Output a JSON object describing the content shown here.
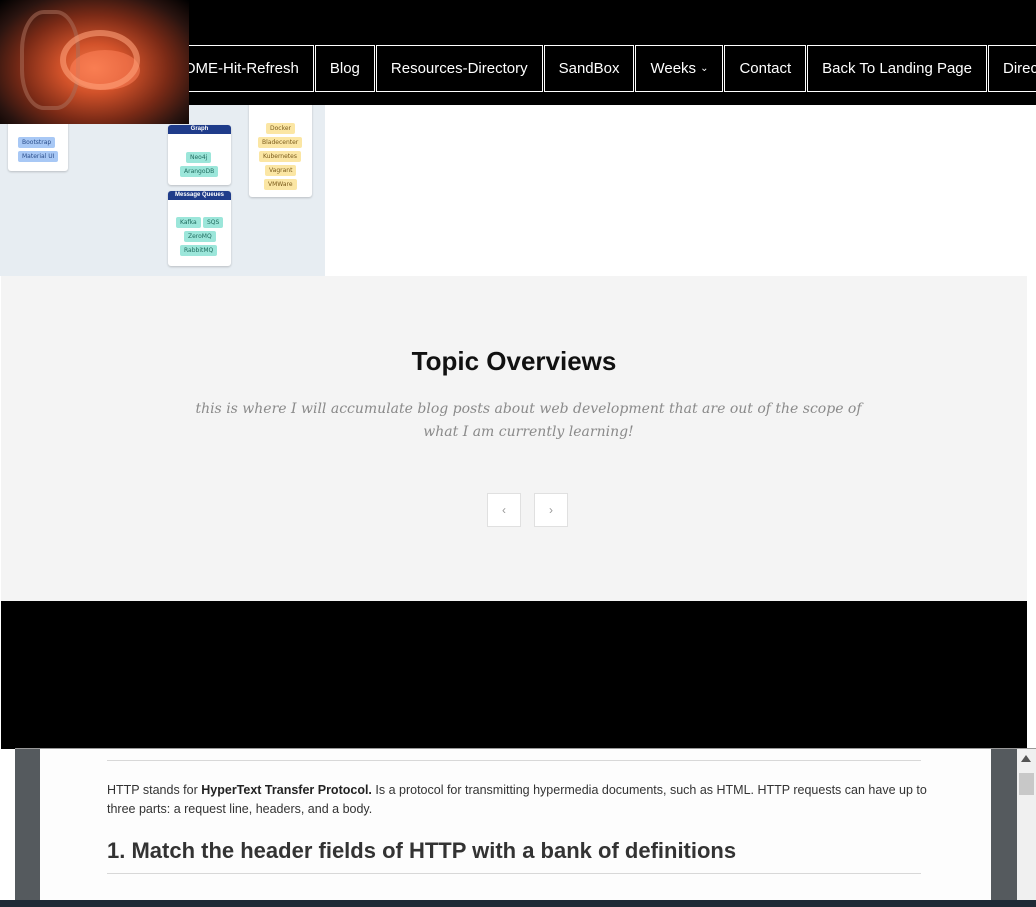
{
  "nav": {
    "items": [
      {
        "label": "HOME-Hit-Refresh"
      },
      {
        "label": "Blog"
      },
      {
        "label": "Resources-Directory"
      },
      {
        "label": "SandBox"
      },
      {
        "label": "Weeks"
      },
      {
        "label": "Contact"
      },
      {
        "label": "Back To Landing Page"
      },
      {
        "label": "Directory"
      }
    ]
  },
  "hero": {
    "cards": [
      {
        "title": "Graph",
        "chips": [
          "Neo4j",
          "ArangoDB"
        ]
      },
      {
        "title": "Message Queues",
        "chips": [
          "Kafka",
          "SQS",
          "ZeroMQ",
          "RabbitMQ"
        ]
      },
      {
        "title": "",
        "chips": [
          "Bootstrap",
          "Material UI"
        ]
      },
      {
        "title": "",
        "chips": [
          "Docker",
          "Bladecenter",
          "Kubernetes",
          "Vagrant",
          "VMWare"
        ]
      }
    ]
  },
  "overview": {
    "title": "Topic Overviews",
    "description": "this is where I will accumulate blog posts about web development that are out of the scope of what I am currently learning!",
    "prev_icon": "chevron-left-icon",
    "next_icon": "chevron-right-icon"
  },
  "doc": {
    "intro_prefix": "HTTP stands for ",
    "intro_bold": "HyperText Transfer Protocol.",
    "intro_rest": " Is a protocol for transmitting hypermedia documents, such as HTML. HTTP requests can have up to three parts: a request line, headers, and a body.",
    "heading": "1. Match the header fields of HTTP with a bank of definitions"
  },
  "colors": {
    "nav_bg": "#000000",
    "overview_bg": "#f4f4f4",
    "chip_blue": "#a8c8f5",
    "chip_teal": "#9ce6da",
    "chip_yellow": "#fbe6a4",
    "card_header": "#1f3c8a"
  }
}
